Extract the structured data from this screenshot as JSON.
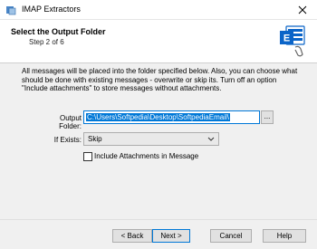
{
  "window": {
    "title": "IMAP Extractors"
  },
  "header": {
    "title": "Select the Output Folder",
    "step": "Step 2 of 6"
  },
  "content": {
    "description": "All messages will be placed into the folder specified below. Also, you can choose what should be done with existing messages - overwrite or skip its. Turn off an option \"Include attachments\" to store messages without attachments.",
    "output_folder_label": "Output Folder:",
    "output_folder_value": "C:\\Users\\Softpedia\\Desktop\\SoftpediaEmail\\",
    "browse_label": "...",
    "if_exists_label": "If Exists:",
    "if_exists_selected": "Skip",
    "include_attachments_label": "Include Attachments in Message",
    "include_attachments_checked": false
  },
  "footer": {
    "back_label": "< Back",
    "next_label": "Next >",
    "cancel_label": "Cancel",
    "help_label": "Help"
  },
  "colors": {
    "accent": "#0078d7",
    "exchange_blue": "#0a64c8"
  }
}
